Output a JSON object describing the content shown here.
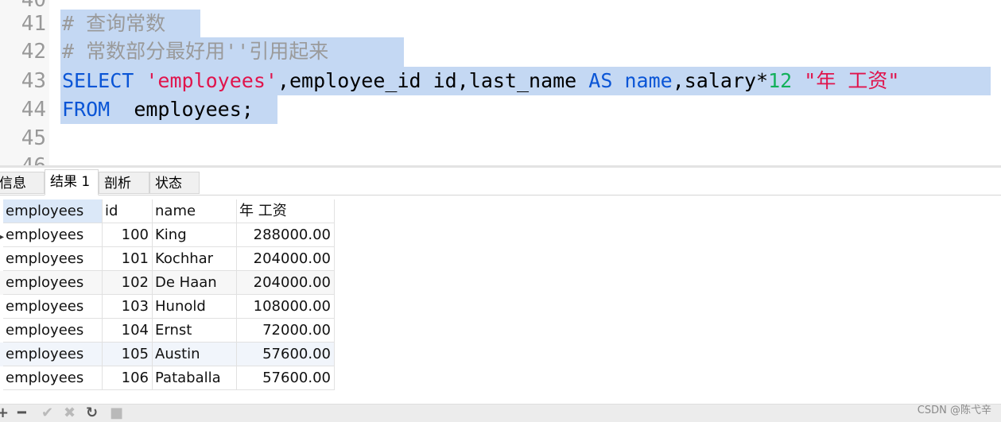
{
  "editor": {
    "lines": [
      {
        "num": "41",
        "text": "# 查询常数"
      },
      {
        "num": "42",
        "text": "# 常数部分最好用''引用起来"
      },
      {
        "num": "43",
        "tokens": [
          "SELECT",
          " ",
          "'employees'",
          ",employee_id id,last_name ",
          "AS",
          " ",
          "name",
          ",salary*",
          "12",
          " ",
          "\"年 工资\""
        ]
      },
      {
        "num": "44",
        "tokens": [
          "FROM",
          "  employees;"
        ]
      },
      {
        "num": "45"
      }
    ],
    "colors": {
      "keyword": "#0a55d6",
      "string": "#e0144c",
      "number": "#12b05a",
      "comment": "#9a9a9a",
      "selection": "#c4d8f3"
    }
  },
  "tabs": [
    "信息",
    "结果 1",
    "剖析",
    "状态"
  ],
  "active_tab": "结果 1",
  "results": {
    "columns": [
      "employees",
      "id",
      "name",
      "年 工资"
    ],
    "rows": [
      [
        "employees",
        "100",
        "King",
        "288000.00"
      ],
      [
        "employees",
        "101",
        "Kochhar",
        "204000.00"
      ],
      [
        "employees",
        "102",
        "De Haan",
        "204000.00"
      ],
      [
        "employees",
        "103",
        "Hunold",
        "108000.00"
      ],
      [
        "employees",
        "104",
        "Ernst",
        "72000.00"
      ],
      [
        "employees",
        "105",
        "Austin",
        "57600.00"
      ],
      [
        "employees",
        "106",
        "Pataballa",
        "57600.00"
      ]
    ]
  },
  "toolbar_icons": [
    "plus-icon",
    "minus-icon",
    "check-icon",
    "x-icon",
    "refresh-icon",
    "stop-icon"
  ],
  "watermark": "CSDN @陈弋辛"
}
